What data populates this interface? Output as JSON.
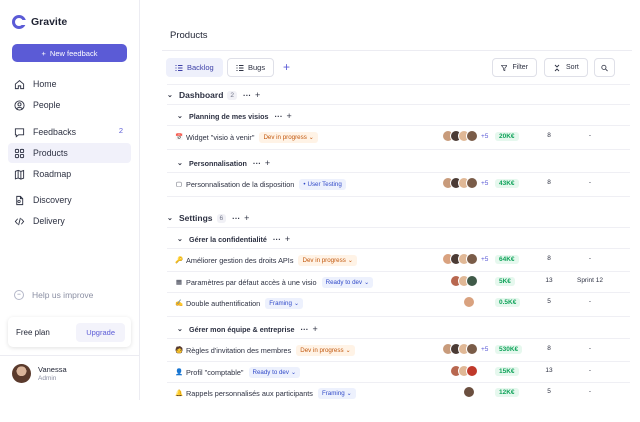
{
  "app": {
    "name": "Gravite"
  },
  "sidebar": {
    "new_feedback": "New feedback",
    "items": [
      {
        "label": "Home",
        "icon": "home-icon"
      },
      {
        "label": "People",
        "icon": "people-icon"
      },
      {
        "label": "Feedbacks",
        "icon": "chat-icon",
        "badge": "2"
      },
      {
        "label": "Products",
        "icon": "grid-icon",
        "active": true
      },
      {
        "label": "Roadmap",
        "icon": "map-icon"
      },
      {
        "label": "Discovery",
        "icon": "document-icon"
      },
      {
        "label": "Delivery",
        "icon": "code-icon"
      }
    ],
    "help": "Help us improve",
    "plan": {
      "label": "Free plan",
      "upgrade": "Upgrade"
    },
    "user": {
      "name": "Vanessa",
      "role": "Admin"
    }
  },
  "main": {
    "title": "Products",
    "tabs": [
      {
        "label": "Backlog"
      },
      {
        "label": "Bugs"
      }
    ],
    "filter": "Filter",
    "sort": "Sort",
    "groups": [
      {
        "name": "Dashboard",
        "count": "2",
        "subgroups": [
          {
            "name": "Planning de mes visios",
            "items": [
              {
                "icon": "📅",
                "title": "Widget \"visio à venir\"",
                "status": "Dev in progress",
                "more": "+5",
                "price": "20K€",
                "num": "8",
                "sprint": "-"
              }
            ]
          },
          {
            "name": "Personnalisation",
            "items": [
              {
                "icon": "▢",
                "title": "Personnalisation de la disposition",
                "status": "User Testing",
                "more": "+5",
                "price": "43K€",
                "num": "8",
                "sprint": "-"
              }
            ]
          }
        ]
      },
      {
        "name": "Settings",
        "count": "6",
        "subgroups": [
          {
            "name": "Gérer la confidentialité",
            "items": [
              {
                "icon": "🔑",
                "title": "Améliorer gestion des droits APIs",
                "status": "Dev in progress",
                "more": "+5",
                "price": "64K€",
                "num": "8",
                "sprint": "-"
              },
              {
                "icon": "▦",
                "title": "Paramètres par défaut accès à une visio",
                "status": "Ready to dev",
                "more": "",
                "price": "5K€",
                "num": "13",
                "sprint": "Sprint 12"
              },
              {
                "icon": "✍",
                "title": "Double authentification",
                "status": "Framing",
                "more": "",
                "price": "0.5K€",
                "num": "5",
                "sprint": "-"
              }
            ]
          },
          {
            "name": "Gérer mon équipe & entreprise",
            "items": [
              {
                "icon": "🧑",
                "title": "Règles d'invitation des membres",
                "status": "Dev in progress",
                "more": "+5",
                "price": "530K€",
                "num": "8",
                "sprint": "-"
              },
              {
                "icon": "👤",
                "title": "Profil \"comptable\"",
                "status": "Ready to dev",
                "more": "",
                "price": "15K€",
                "num": "13",
                "sprint": "-"
              },
              {
                "icon": "🔔",
                "title": "Rappels personnalisés aux participants",
                "status": "Framing",
                "more": "",
                "price": "12K€",
                "num": "5",
                "sprint": "-"
              }
            ]
          }
        ]
      }
    ]
  },
  "colors": {
    "accent": "#5b5bd6",
    "progress": "#c2570c",
    "ready": "#3049c8",
    "money": "#10a35a"
  }
}
